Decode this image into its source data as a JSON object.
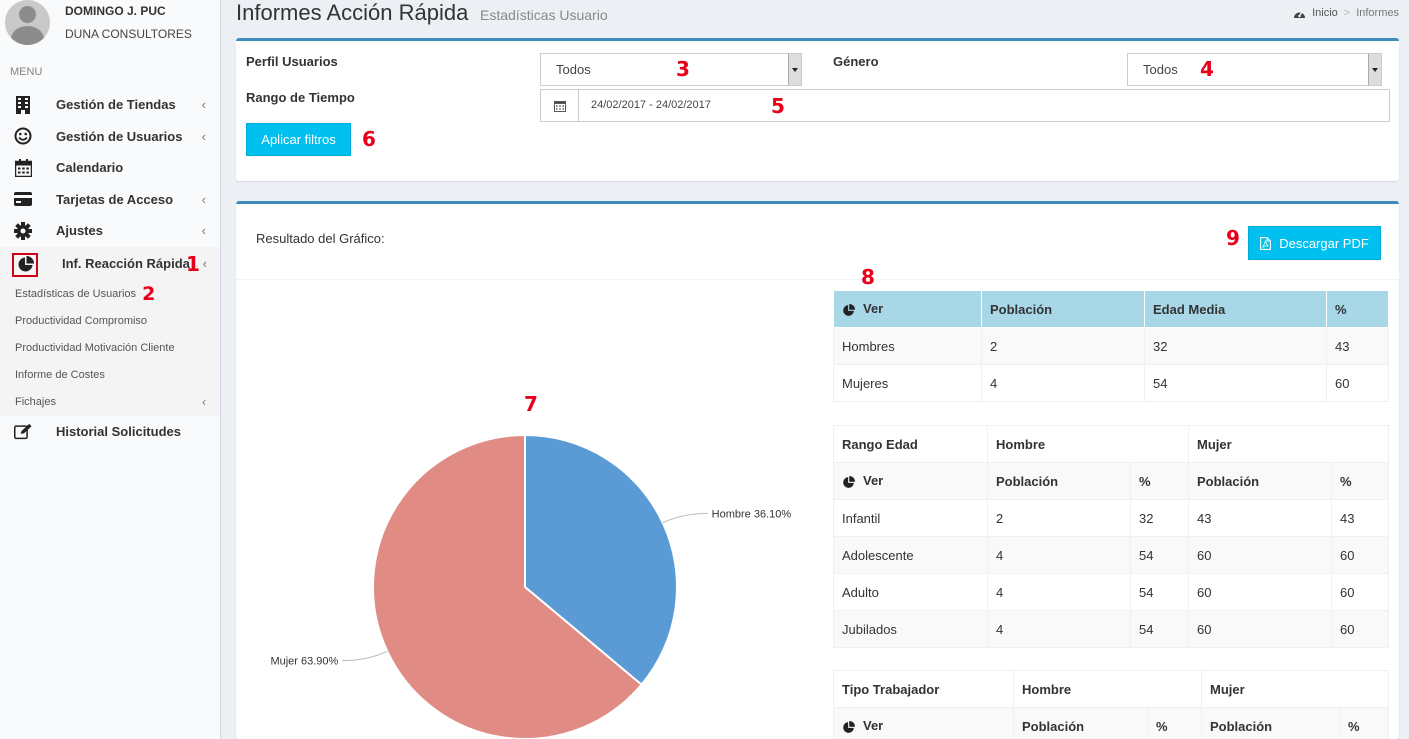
{
  "user": {
    "name": "DOMINGO J. PUC",
    "company": "DUNA CONSULTORES"
  },
  "sidebar": {
    "menu_header": "MENU",
    "items": [
      {
        "label": "Gestión de Tiendas",
        "icon": "building-icon",
        "has_chevron": true
      },
      {
        "label": "Gestión de Usuarios",
        "icon": "smile-icon",
        "has_chevron": true
      },
      {
        "label": "Calendario",
        "icon": "calendar-icon",
        "has_chevron": false
      },
      {
        "label": "Tarjetas de Acceso",
        "icon": "credit-card-icon",
        "has_chevron": true
      },
      {
        "label": "Ajustes",
        "icon": "gear-icon",
        "has_chevron": true
      },
      {
        "label": "Inf. Reacción Rápida",
        "icon": "pie-chart-icon",
        "has_chevron": true,
        "annotation": "1"
      }
    ],
    "submenu": [
      {
        "label": "Estadísticas de Usuarios",
        "annotation": "2"
      },
      {
        "label": "Productividad Compromiso"
      },
      {
        "label": "Productividad Motivación Cliente"
      },
      {
        "label": "Informe de Costes"
      },
      {
        "label": "Fichajes",
        "has_chevron": true
      }
    ],
    "last_item": {
      "label": "Historial Solicitudes",
      "icon": "edit-icon"
    },
    "chevron": "‹"
  },
  "header": {
    "title": "Informes Acción Rápida",
    "subtitle": "Estadísticas Usuario",
    "breadcrumb": {
      "home": "Inicio",
      "separator": ">",
      "current": "Informes"
    }
  },
  "filters": {
    "perfil_label": "Perfil Usuarios",
    "perfil_value": "Todos",
    "genero_label": "Género",
    "genero_value": "Todos",
    "rango_label": "Rango de Tiempo",
    "date_range": "24/02/2017 - 24/02/2017",
    "apply_label": "Aplicar filtros",
    "annotations": {
      "perfil": "3",
      "genero": "4",
      "date": "5",
      "apply": "6"
    }
  },
  "results": {
    "label": "Resultado del Gráfico:",
    "pdf_label": "Descargar PDF",
    "annotations": {
      "pdf": "9",
      "table": "8",
      "chart": "7"
    }
  },
  "chart_data": {
    "type": "pie",
    "categories": [
      "Hombre",
      "Mujer"
    ],
    "values": [
      36.1,
      63.9
    ],
    "labels": [
      "Hombre 36.10%",
      "Mujer 63.90%"
    ],
    "colors": [
      "#5b9bd5",
      "#e08b84"
    ],
    "title": ""
  },
  "table_gender": {
    "headers": [
      "Ver",
      "Población",
      "Edad Media",
      "%"
    ],
    "rows": [
      [
        "Hombres",
        "2",
        "32",
        "43"
      ],
      [
        "Mujeres",
        "4",
        "54",
        "60"
      ]
    ]
  },
  "table_age": {
    "group_headers": [
      "Rango Edad",
      "Hombre",
      "Mujer"
    ],
    "sub_headers": [
      "Ver",
      "Población",
      "%",
      "Población",
      "%"
    ],
    "rows": [
      [
        "Infantil",
        "2",
        "32",
        "43",
        "43"
      ],
      [
        "Adolescente",
        "4",
        "54",
        "60",
        "60"
      ],
      [
        "Adulto",
        "4",
        "54",
        "60",
        "60"
      ],
      [
        "Jubilados",
        "4",
        "54",
        "60",
        "60"
      ]
    ]
  },
  "table_worker": {
    "group_headers": [
      "Tipo Trabajador",
      "Hombre",
      "Mujer"
    ],
    "sub_headers": [
      "Ver",
      "Población",
      "%",
      "Población",
      "%"
    ]
  }
}
